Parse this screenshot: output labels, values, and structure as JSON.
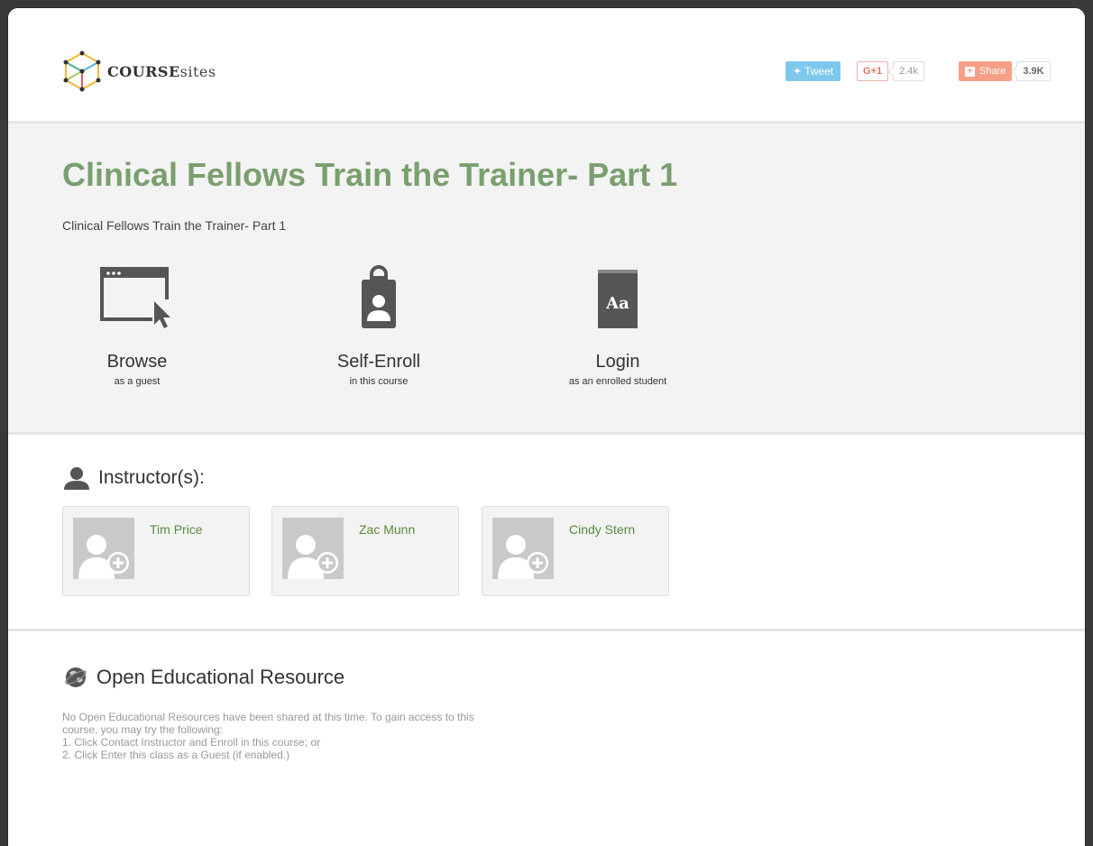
{
  "header": {
    "logo": {
      "brand_bold": "COURSE",
      "brand_rest": "sites"
    },
    "social": {
      "tweet_label": "Tweet",
      "gplus_label": "G+1",
      "gplus_count": "2.4k",
      "share_label": "Share",
      "share_count": "3.9K"
    }
  },
  "course": {
    "title": "Clinical Fellows Train the Trainer- Part 1",
    "subtitle": "Clinical Fellows Train the Trainer- Part 1",
    "actions": [
      {
        "icon": "browser-window-cursor-icon",
        "label": "Browse",
        "sub": "as a guest"
      },
      {
        "icon": "id-badge-icon",
        "label": "Self-Enroll",
        "sub": "in this course"
      },
      {
        "icon": "dictionary-book-icon",
        "label": "Login",
        "sub": "as an enrolled student"
      }
    ]
  },
  "instructors": {
    "heading": "Instructor(s):",
    "list": [
      {
        "name": "Tim Price"
      },
      {
        "name": "Zac Munn"
      },
      {
        "name": "Cindy Stern"
      }
    ]
  },
  "oer": {
    "heading": "Open Educational Resource",
    "lines": [
      "No Open Educational Resources have been shared at this time. To gain access to this",
      "course, you may try the following:",
      "1. Click Contact Instructor and Enroll in this course; or",
      "2. Click Enter this class as a Guest (if enabled.)"
    ]
  },
  "colors": {
    "title_green": "#7a9f6e",
    "name_green": "#5a8a3c",
    "tweet_blue": "#7ec8ed",
    "share_orange": "#f5a086"
  }
}
